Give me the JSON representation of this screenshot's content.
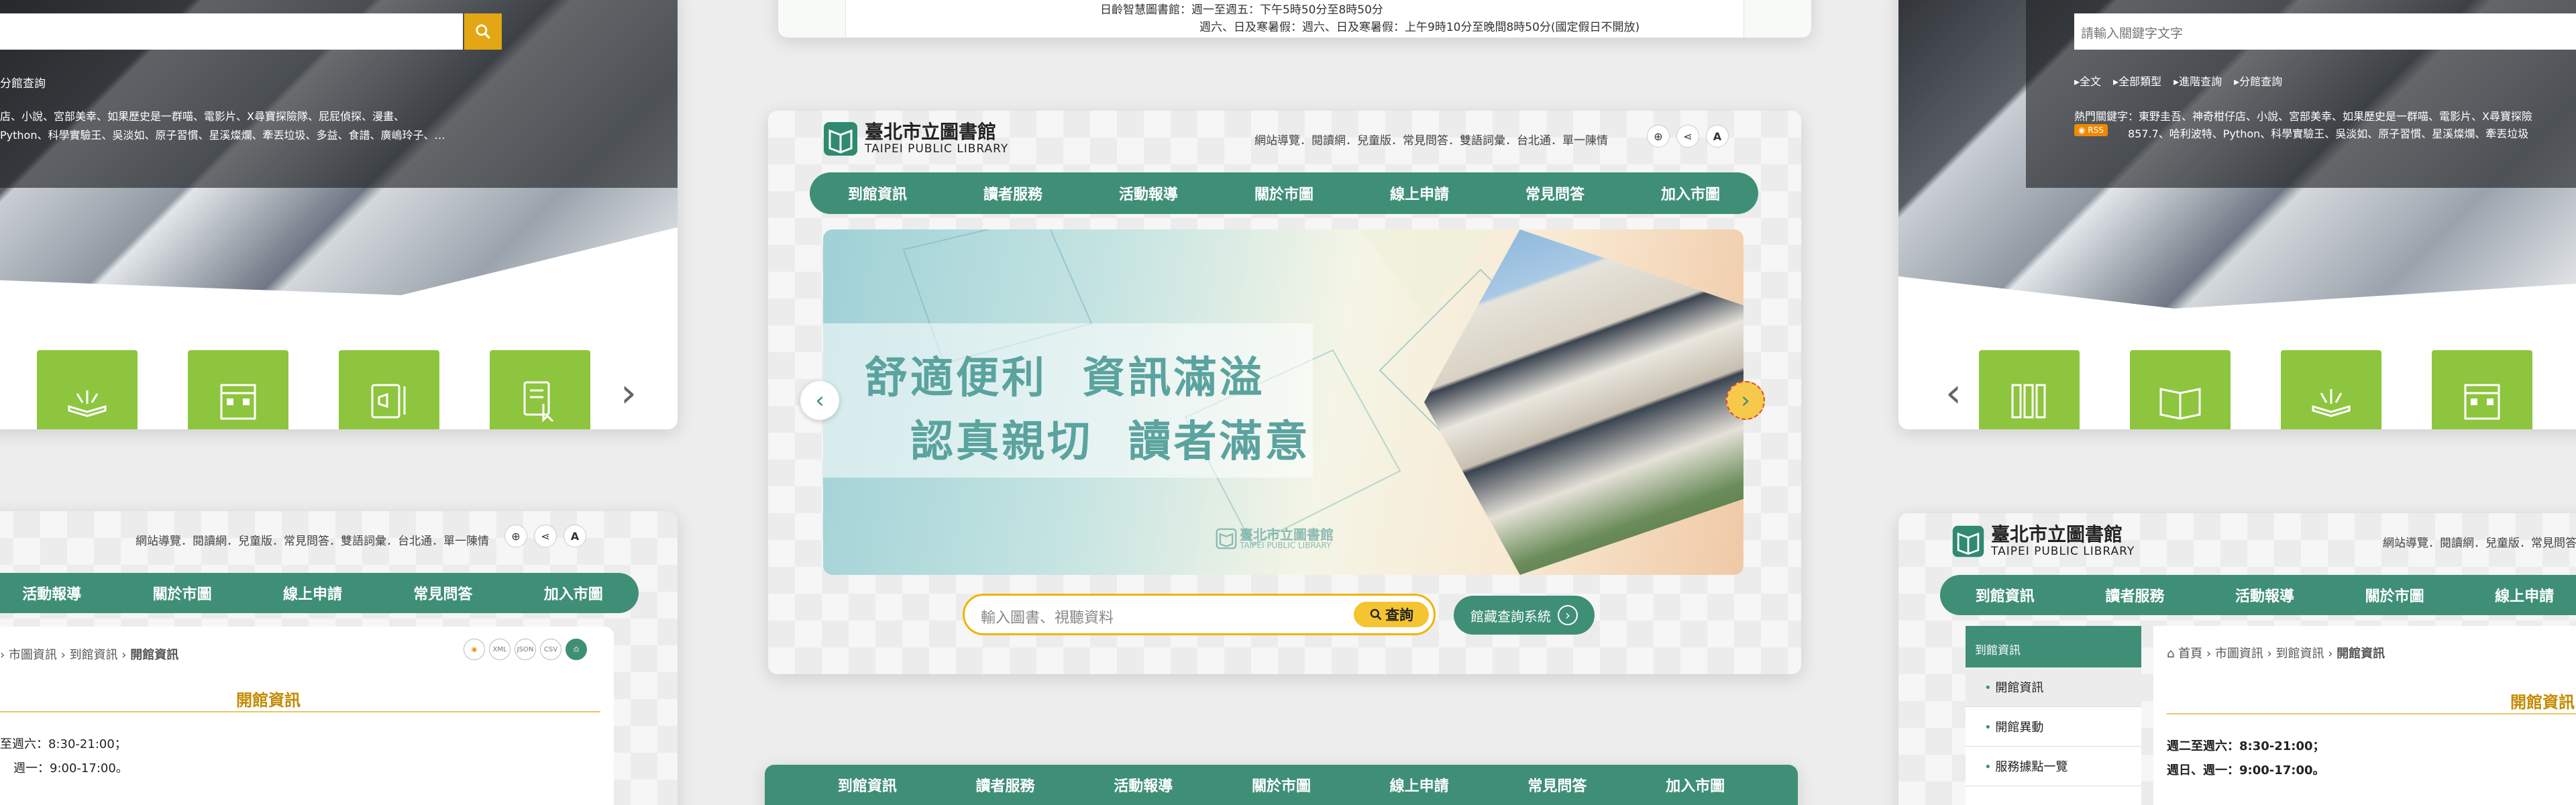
{
  "top_left": {
    "search_btn": "search-icon",
    "links": "分館查詢",
    "hot_line1": "店、小說、宮部美幸、如果歷史是一群喵、電影片、X尋寶探險隊、屁屁偵探、漫畫、",
    "hot_line2": "Python、科學實驗王、吳淡如、原子習慣、星溪燦爛、牽丟垃圾、多益、食譜、廣嶋玲子、…"
  },
  "top_center": {
    "line1": "日齡智慧圖書館：週一至週五：下午5時50分至8時50分",
    "line2": "週六、日及寒暑假：週六、日及寒暑假：上午9時10分至晚間8時50分(國定假日不開放)"
  },
  "top_right": {
    "placeholder": "請輸入關鍵字文字",
    "links": [
      "全文",
      "全部類型",
      "進階查詢",
      "分館查詢"
    ],
    "hot_line1": "熱門關鍵字：東野圭吾、神奇柑仔店、小說、宮部美幸、如果歷史是一群喵、電影片、X尋寶探險",
    "rss": "RSS",
    "hot_line2": "857.7、哈利波特、Python、科學實驗王、吳淡如、原子習慣、星溪燦爛、牽丟垃圾"
  },
  "center": {
    "logo_cn": "臺北市立圖書館",
    "logo_en": "TAIPEI PUBLIC LIBRARY",
    "util_links": "網站導覽．閱讀網．兒童版．常見問答．雙語詞彙．台北通．單一陳情",
    "icons": [
      "globe-icon",
      "share-icon",
      "font-size-icon"
    ],
    "font_label": "A",
    "nav": [
      "到館資訊",
      "讀者服務",
      "活動報導",
      "關於市圖",
      "線上申請",
      "常見問答",
      "加入市圖"
    ],
    "banner_line1": "舒適便利  資訊滿溢",
    "banner_line2": "認真親切  讀者滿意",
    "banner_logo_cn": "臺北市立圖書館",
    "banner_logo_en": "TAIPEI PUBLIC LIBRARY",
    "search_placeholder": "輸入圖書、視聽資料",
    "search_btn": "查詢",
    "catalog_btn": "館藏查詢系統"
  },
  "bottom_left": {
    "util_links": "網站導覽．閱讀網．兒童版．常見問答．雙語詞彙．台北通．單一陳情",
    "nav": [
      "活動報導",
      "關於市圖",
      "線上申請",
      "常見問答",
      "加入市圖"
    ],
    "crumbs": [
      "市圖資訊",
      "到館資訊",
      "開館資訊"
    ],
    "formats": [
      "XML",
      "JSON",
      "CSV"
    ],
    "title": "開館資訊",
    "hours1": "至週六：8:30-21:00；",
    "hours2": "週一：9:00-17:00。"
  },
  "bottom_center": {
    "nav": [
      "到館資訊",
      "讀者服務",
      "活動報導",
      "關於市圖",
      "線上申請",
      "常見問答",
      "加入市圖"
    ]
  },
  "bottom_right": {
    "logo_cn": "臺北市立圖書館",
    "logo_en": "TAIPEI PUBLIC LIBRARY",
    "util_links": "網站導覽．閱讀網．兒童版．常見問答．雙語詞彙．台北通．單一陳情",
    "nav": [
      "到館資訊",
      "讀者服務",
      "活動報導",
      "關於市圖",
      "線上申請"
    ],
    "side_title": "到館資訊",
    "side_items": [
      "開館資訊",
      "開館異動",
      "服務據點一覽"
    ],
    "crumbs": [
      "首頁",
      "市圖資訊",
      "到館資訊",
      "開館資訊"
    ],
    "title": "開館資訊",
    "hours1": "週二至週六：8:30-21:00；",
    "hours2": "週日、週一：9:00-17:00。"
  }
}
